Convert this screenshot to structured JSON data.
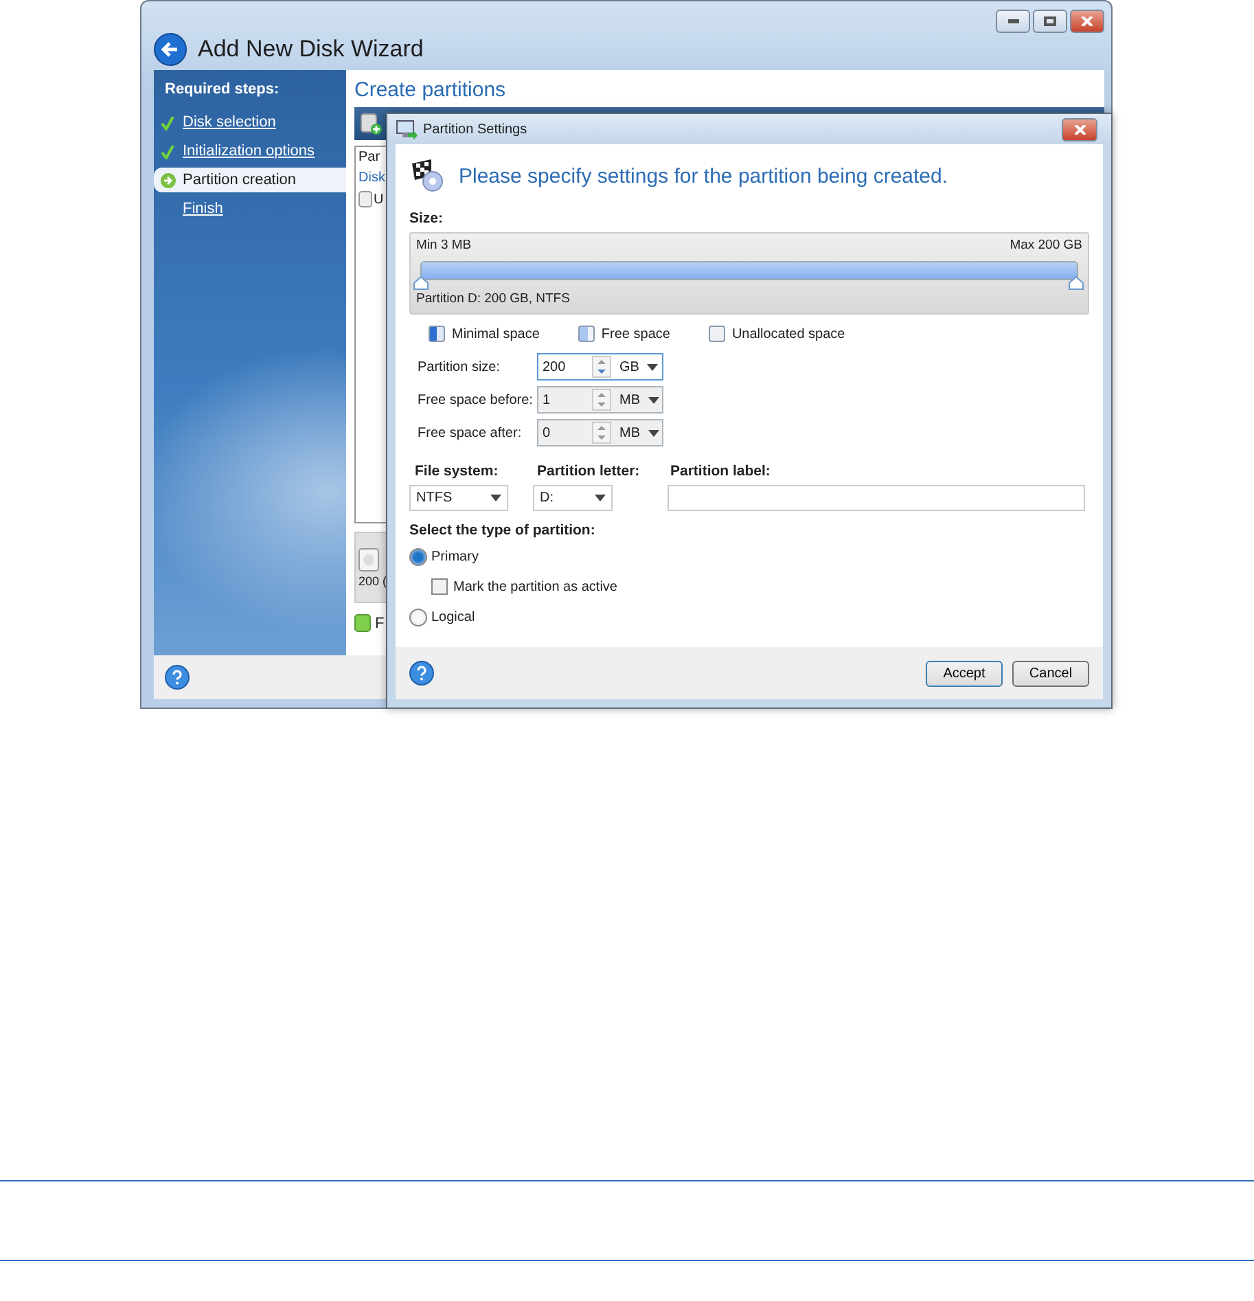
{
  "window": {
    "title": "Add New Disk Wizard"
  },
  "sidebar": {
    "heading": "Required steps:",
    "steps": [
      {
        "label": "Disk selection",
        "kind": "done",
        "selected": false
      },
      {
        "label": "Initialization options",
        "kind": "done",
        "selected": false
      },
      {
        "label": "Partition creation",
        "kind": "current",
        "selected": true
      },
      {
        "label": "Finish",
        "kind": "pending",
        "selected": false
      }
    ]
  },
  "page": {
    "title": "Create partitions",
    "table_header": "Par",
    "table_row": "Disk",
    "table_item": "U",
    "disk_size": "200 (",
    "legend_item": "F"
  },
  "dialog": {
    "title": "Partition Settings",
    "heading": "Please specify settings for the partition being created.",
    "size_label": "Size:",
    "slider": {
      "min_label": "Min 3 MB",
      "max_label": "Max 200 GB",
      "caption": "Partition D: 200 GB, NTFS",
      "level": 1
    },
    "legend": [
      {
        "label": "Minimal space",
        "kind": "minimal"
      },
      {
        "label": "Free space",
        "kind": "free"
      },
      {
        "label": "Unallocated space",
        "kind": "unallocated"
      }
    ],
    "spinners": [
      {
        "label": "Partition size:",
        "value": "200",
        "unit": "GB",
        "focused": true
      },
      {
        "label": "Free space before:",
        "value": "1",
        "unit": "MB",
        "focused": false
      },
      {
        "label": "Free space after:",
        "value": "0",
        "unit": "MB",
        "focused": false
      }
    ],
    "file_system": {
      "label": "File system:",
      "value": "NTFS"
    },
    "partition_letter": {
      "label": "Partition letter:",
      "value": "D:"
    },
    "partition_label": {
      "label": "Partition label:"
    },
    "partition_type": {
      "label": "Select the type of partition:",
      "options": [
        {
          "label": "Primary",
          "selected": true
        },
        {
          "label": "Logical",
          "selected": false
        }
      ],
      "active_checkbox": {
        "label": "Mark the partition as active",
        "checked": false
      }
    },
    "buttons": [
      {
        "label": "Accept",
        "default": true
      },
      {
        "label": "Cancel",
        "default": false
      }
    ]
  }
}
